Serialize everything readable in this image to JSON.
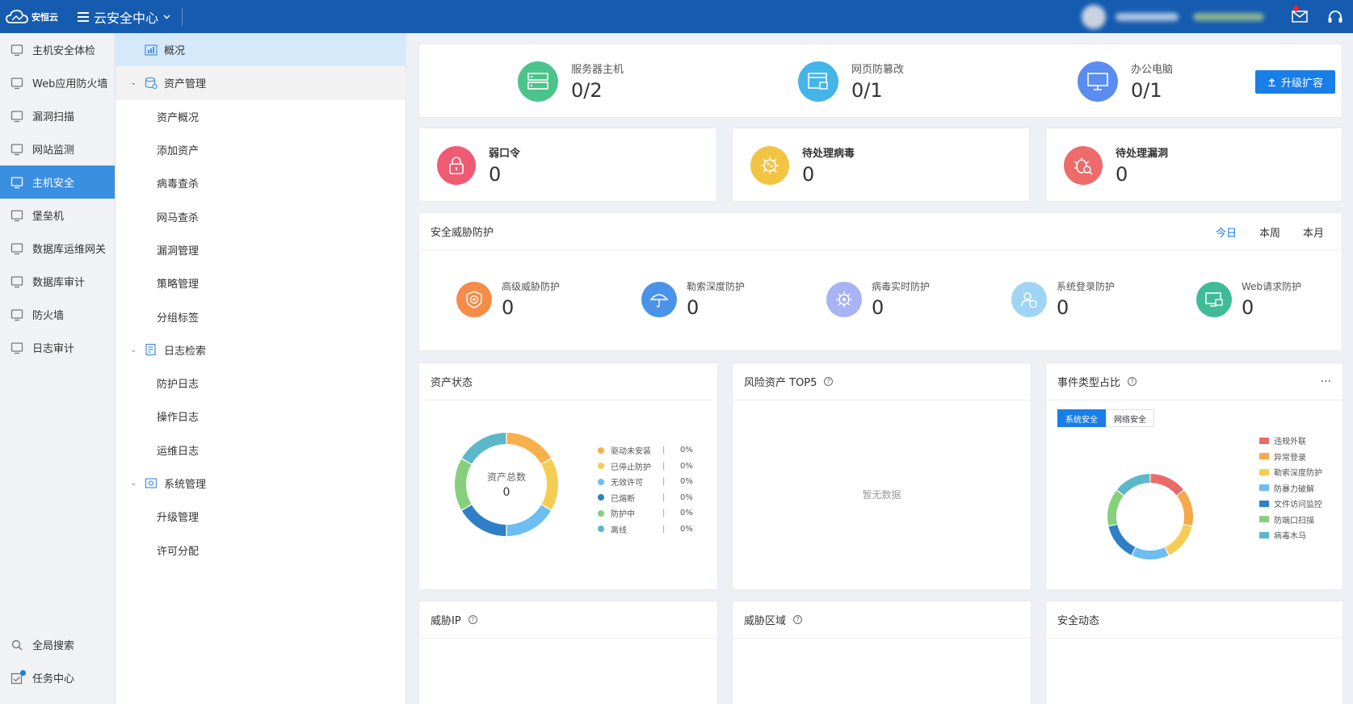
{
  "topbar": {
    "logo_text": "安恒云",
    "app_title": "云安全中心",
    "colors": {
      "bar": "#155bb0"
    }
  },
  "sidebar_main": {
    "items": [
      {
        "label": "主机安全体检",
        "icon": "monitor-plus-icon"
      },
      {
        "label": "Web应用防火墙",
        "icon": "shield-wings-icon"
      },
      {
        "label": "漏洞扫描",
        "icon": "radar-icon"
      },
      {
        "label": "网站监测",
        "icon": "gauge-icon"
      },
      {
        "label": "主机安全",
        "icon": "desktop-icon"
      },
      {
        "label": "堡垒机",
        "icon": "shield-icon"
      },
      {
        "label": "数据库运维网关",
        "icon": "database-icon"
      },
      {
        "label": "数据库审计",
        "icon": "database-search-icon"
      },
      {
        "label": "防火墙",
        "icon": "firewall-icon"
      },
      {
        "label": "日志审计",
        "icon": "log-search-icon"
      }
    ],
    "bottom": [
      {
        "label": "全局搜索",
        "icon": "search-icon"
      },
      {
        "label": "任务中心",
        "icon": "task-icon"
      }
    ]
  },
  "sidebar_sub": {
    "overview": "概况",
    "asset_mgmt": "资产管理",
    "asset_items": [
      "资产概况",
      "添加资产",
      "病毒查杀",
      "网马查杀",
      "漏洞管理",
      "策略管理",
      "分组标签"
    ],
    "log_search": "日志检索",
    "log_items": [
      "防护日志",
      "操作日志",
      "运维日志"
    ],
    "system_mgmt": "系统管理",
    "system_items": [
      "升级管理",
      "许可分配"
    ]
  },
  "summary": {
    "items": [
      {
        "label": "服务器主机",
        "value": "0/2",
        "color": "#4cc38a"
      },
      {
        "label": "网页防篡改",
        "value": "0/1",
        "color": "#45b4e8"
      },
      {
        "label": "办公电脑",
        "value": "0/1",
        "color": "#5b8df0"
      }
    ],
    "upgrade_button": "升级扩容"
  },
  "pending": [
    {
      "label": "弱口令",
      "value": "0",
      "color": "#ef5b73"
    },
    {
      "label": "待处理病毒",
      "value": "0",
      "color": "#f3c443"
    },
    {
      "label": "待处理漏洞",
      "value": "0",
      "color": "#ef6a6a"
    }
  ],
  "threat": {
    "title": "安全威胁防护",
    "tabs": [
      "今日",
      "本周",
      "本月"
    ],
    "active_tab": "今日",
    "items": [
      {
        "label": "高级威胁防护",
        "value": "0",
        "color": "#f58c49"
      },
      {
        "label": "勒索深度防护",
        "value": "0",
        "color": "#4a93e8"
      },
      {
        "label": "病毒实时防护",
        "value": "0",
        "color": "#a7b3f2"
      },
      {
        "label": "系统登录防护",
        "value": "0",
        "color": "#9fd4f4"
      },
      {
        "label": "Web请求防护",
        "value": "0",
        "color": "#3fbb98"
      }
    ]
  },
  "asset_status": {
    "title": "资产状态",
    "center_label": "资产总数",
    "center_value": "0",
    "legend": [
      {
        "name": "驱动未安装",
        "pct": "0%",
        "color": "#f7b04b"
      },
      {
        "name": "已停止防护",
        "pct": "0%",
        "color": "#f6cd53"
      },
      {
        "name": "无效许可",
        "pct": "0%",
        "color": "#6dbdf2"
      },
      {
        "name": "已熔断",
        "pct": "0%",
        "color": "#2e7fc7"
      },
      {
        "name": "防护中",
        "pct": "0%",
        "color": "#86d07c"
      },
      {
        "name": "离线",
        "pct": "0%",
        "color": "#5bb8c8"
      }
    ],
    "separator": "|"
  },
  "risk_top5": {
    "title": "风险资产 TOP5",
    "empty_text": "暂无数据"
  },
  "event_type": {
    "title": "事件类型占比",
    "more": "···",
    "tabs": [
      "系统安全",
      "网络安全"
    ],
    "active_tab": "系统安全",
    "legend": [
      {
        "name": "违规外联",
        "color": "#ea6a6a"
      },
      {
        "name": "异常登录",
        "color": "#f5a94a"
      },
      {
        "name": "勒索深度防护",
        "color": "#f6cd53"
      },
      {
        "name": "防暴力破解",
        "color": "#6dbdf2"
      },
      {
        "name": "文件访问监控",
        "color": "#2e7fc7"
      },
      {
        "name": "防端口扫描",
        "color": "#86d07c"
      },
      {
        "name": "病毒木马",
        "color": "#5bb8c8"
      }
    ]
  },
  "bottom_cards": [
    {
      "title": "威胁IP",
      "help": true
    },
    {
      "title": "威胁区域",
      "help": true
    },
    {
      "title": "安全动态",
      "help": false
    }
  ]
}
